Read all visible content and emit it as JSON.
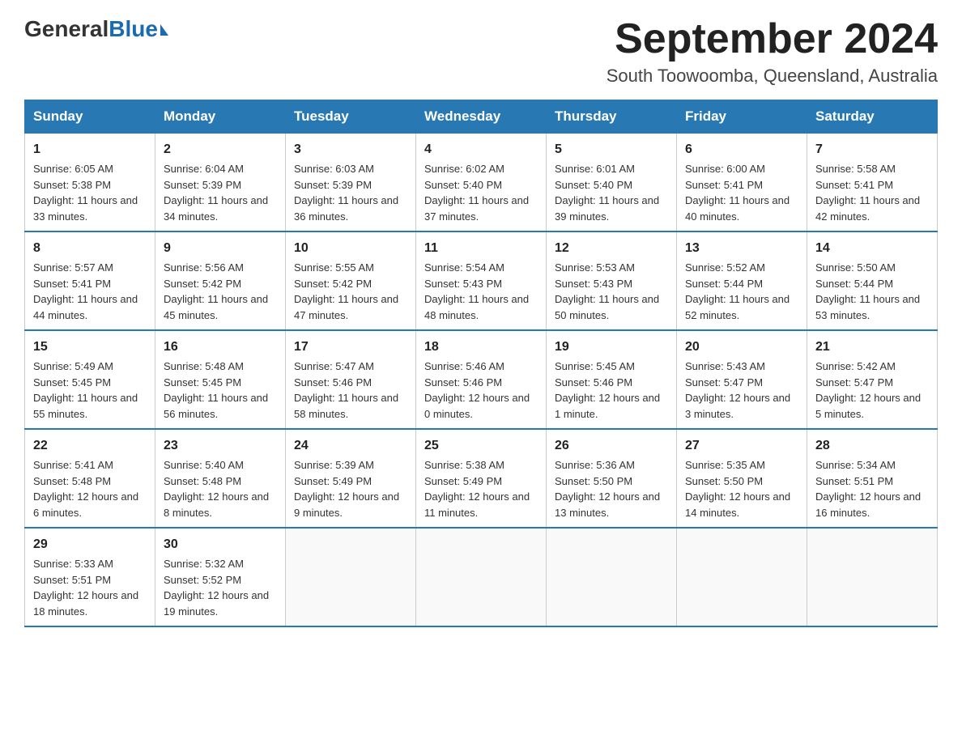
{
  "logo": {
    "general": "General",
    "blue": "Blue"
  },
  "header": {
    "month_year": "September 2024",
    "location": "South Toowoomba, Queensland, Australia"
  },
  "days_of_week": [
    "Sunday",
    "Monday",
    "Tuesday",
    "Wednesday",
    "Thursday",
    "Friday",
    "Saturday"
  ],
  "weeks": [
    [
      {
        "day": "1",
        "sunrise": "6:05 AM",
        "sunset": "5:38 PM",
        "daylight": "11 hours and 33 minutes."
      },
      {
        "day": "2",
        "sunrise": "6:04 AM",
        "sunset": "5:39 PM",
        "daylight": "11 hours and 34 minutes."
      },
      {
        "day": "3",
        "sunrise": "6:03 AM",
        "sunset": "5:39 PM",
        "daylight": "11 hours and 36 minutes."
      },
      {
        "day": "4",
        "sunrise": "6:02 AM",
        "sunset": "5:40 PM",
        "daylight": "11 hours and 37 minutes."
      },
      {
        "day": "5",
        "sunrise": "6:01 AM",
        "sunset": "5:40 PM",
        "daylight": "11 hours and 39 minutes."
      },
      {
        "day": "6",
        "sunrise": "6:00 AM",
        "sunset": "5:41 PM",
        "daylight": "11 hours and 40 minutes."
      },
      {
        "day": "7",
        "sunrise": "5:58 AM",
        "sunset": "5:41 PM",
        "daylight": "11 hours and 42 minutes."
      }
    ],
    [
      {
        "day": "8",
        "sunrise": "5:57 AM",
        "sunset": "5:41 PM",
        "daylight": "11 hours and 44 minutes."
      },
      {
        "day": "9",
        "sunrise": "5:56 AM",
        "sunset": "5:42 PM",
        "daylight": "11 hours and 45 minutes."
      },
      {
        "day": "10",
        "sunrise": "5:55 AM",
        "sunset": "5:42 PM",
        "daylight": "11 hours and 47 minutes."
      },
      {
        "day": "11",
        "sunrise": "5:54 AM",
        "sunset": "5:43 PM",
        "daylight": "11 hours and 48 minutes."
      },
      {
        "day": "12",
        "sunrise": "5:53 AM",
        "sunset": "5:43 PM",
        "daylight": "11 hours and 50 minutes."
      },
      {
        "day": "13",
        "sunrise": "5:52 AM",
        "sunset": "5:44 PM",
        "daylight": "11 hours and 52 minutes."
      },
      {
        "day": "14",
        "sunrise": "5:50 AM",
        "sunset": "5:44 PM",
        "daylight": "11 hours and 53 minutes."
      }
    ],
    [
      {
        "day": "15",
        "sunrise": "5:49 AM",
        "sunset": "5:45 PM",
        "daylight": "11 hours and 55 minutes."
      },
      {
        "day": "16",
        "sunrise": "5:48 AM",
        "sunset": "5:45 PM",
        "daylight": "11 hours and 56 minutes."
      },
      {
        "day": "17",
        "sunrise": "5:47 AM",
        "sunset": "5:46 PM",
        "daylight": "11 hours and 58 minutes."
      },
      {
        "day": "18",
        "sunrise": "5:46 AM",
        "sunset": "5:46 PM",
        "daylight": "12 hours and 0 minutes."
      },
      {
        "day": "19",
        "sunrise": "5:45 AM",
        "sunset": "5:46 PM",
        "daylight": "12 hours and 1 minute."
      },
      {
        "day": "20",
        "sunrise": "5:43 AM",
        "sunset": "5:47 PM",
        "daylight": "12 hours and 3 minutes."
      },
      {
        "day": "21",
        "sunrise": "5:42 AM",
        "sunset": "5:47 PM",
        "daylight": "12 hours and 5 minutes."
      }
    ],
    [
      {
        "day": "22",
        "sunrise": "5:41 AM",
        "sunset": "5:48 PM",
        "daylight": "12 hours and 6 minutes."
      },
      {
        "day": "23",
        "sunrise": "5:40 AM",
        "sunset": "5:48 PM",
        "daylight": "12 hours and 8 minutes."
      },
      {
        "day": "24",
        "sunrise": "5:39 AM",
        "sunset": "5:49 PM",
        "daylight": "12 hours and 9 minutes."
      },
      {
        "day": "25",
        "sunrise": "5:38 AM",
        "sunset": "5:49 PM",
        "daylight": "12 hours and 11 minutes."
      },
      {
        "day": "26",
        "sunrise": "5:36 AM",
        "sunset": "5:50 PM",
        "daylight": "12 hours and 13 minutes."
      },
      {
        "day": "27",
        "sunrise": "5:35 AM",
        "sunset": "5:50 PM",
        "daylight": "12 hours and 14 minutes."
      },
      {
        "day": "28",
        "sunrise": "5:34 AM",
        "sunset": "5:51 PM",
        "daylight": "12 hours and 16 minutes."
      }
    ],
    [
      {
        "day": "29",
        "sunrise": "5:33 AM",
        "sunset": "5:51 PM",
        "daylight": "12 hours and 18 minutes."
      },
      {
        "day": "30",
        "sunrise": "5:32 AM",
        "sunset": "5:52 PM",
        "daylight": "12 hours and 19 minutes."
      },
      null,
      null,
      null,
      null,
      null
    ]
  ],
  "labels": {
    "sunrise": "Sunrise:",
    "sunset": "Sunset:",
    "daylight": "Daylight:"
  }
}
